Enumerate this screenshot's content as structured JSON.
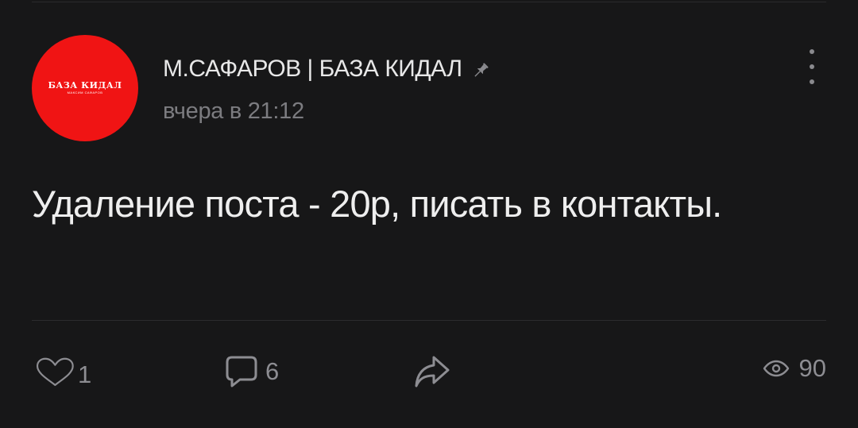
{
  "post": {
    "avatar": {
      "title": "БАЗА КИДАЛ",
      "subtitle": "МАКСИМ САФАРОВ",
      "color": "#f01414"
    },
    "author_name": "М.САФАРОВ | БАЗА КИДАЛ",
    "pin_icon": "pin-icon",
    "time": "вчера в 21:12",
    "text": "Удаление поста - 20р, писать в контакты.",
    "actions": {
      "likes": "1",
      "comments": "6",
      "views": "90"
    }
  },
  "colors": {
    "background": "#171718",
    "text": "#eeeeee",
    "muted": "#8d8d92"
  }
}
